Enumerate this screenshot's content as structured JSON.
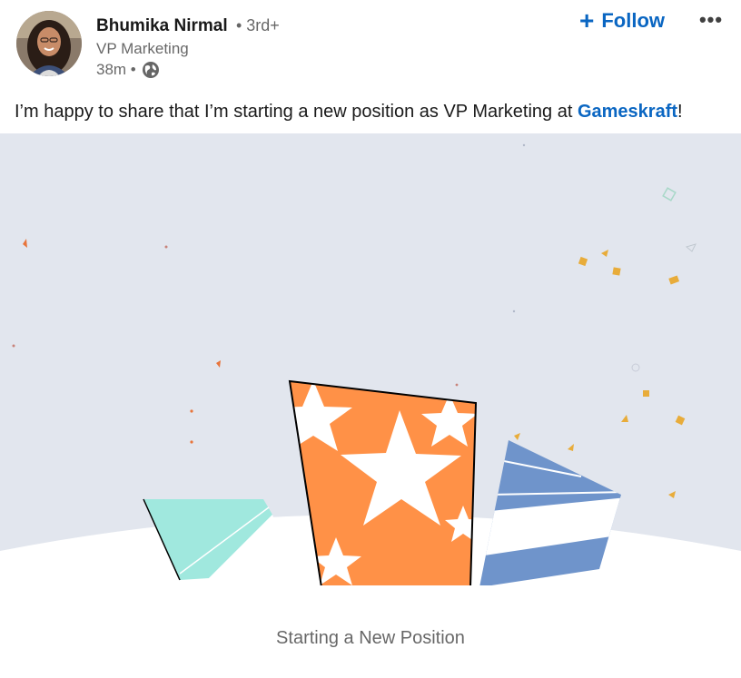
{
  "author": {
    "name": "Bhumika Nirmal",
    "degree": "• 3rd+",
    "headline": "VP Marketing",
    "time": "38m •"
  },
  "actions": {
    "follow_plus": "+",
    "follow_label": "Follow",
    "more_label": "•••"
  },
  "post": {
    "text_before": "I’m happy to share that I’m starting a new position as VP Marketing at ",
    "company": "Gameskraft",
    "text_after": "!"
  },
  "caption": "Starting a New Position",
  "colors": {
    "link": "#0a66c2",
    "background_illustration": "#e2e6ee",
    "orange_card": "#ff9147",
    "blue_card": "#6f94cb",
    "teal_card": "#a0e8de",
    "confetti_gold": "#e8ac3a"
  },
  "icons": {
    "globe": "globe-icon",
    "follow": "plus-icon",
    "more": "ellipsis-icon"
  }
}
